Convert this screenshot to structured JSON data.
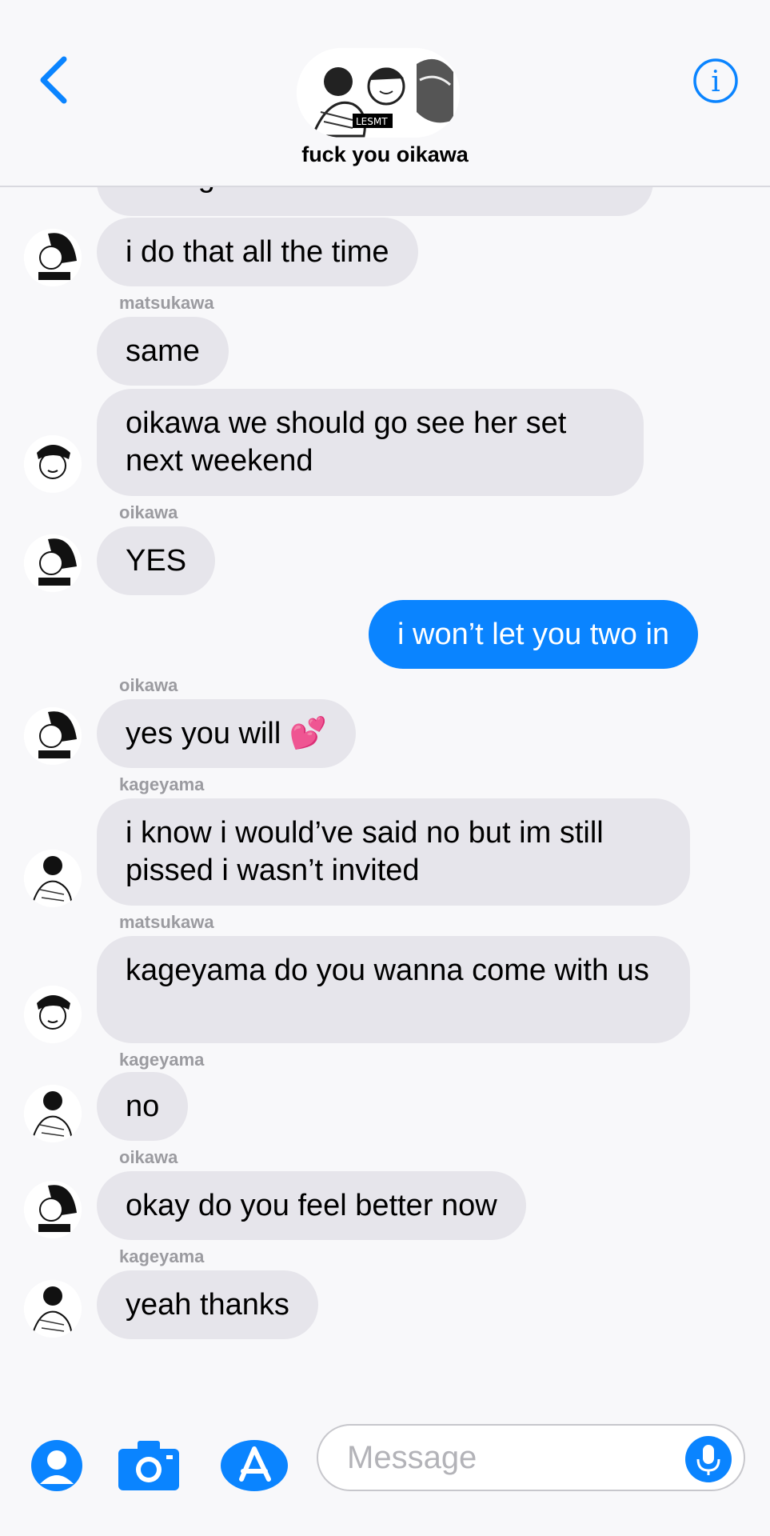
{
  "header": {
    "back_icon": "chevron-left-icon",
    "title": "fuck you oikawa",
    "info_icon": "info-icon",
    "accent": "#0a84ff"
  },
  "messages": [
    {
      "sender": "",
      "text": "lurking",
      "from": "them",
      "avatar": "oikawa"
    },
    {
      "sender": "",
      "text": "i do that all the time",
      "from": "them",
      "avatar": "oikawa"
    },
    {
      "sender": "matsukawa",
      "text": "same",
      "from": "them",
      "avatar": "matsukawa"
    },
    {
      "sender": "",
      "text": "oikawa we should go see her set next weekend",
      "from": "them",
      "avatar": "matsukawa"
    },
    {
      "sender": "oikawa",
      "text": "YES",
      "from": "them",
      "avatar": "oikawa"
    },
    {
      "sender": "",
      "text": "i won’t let you two in",
      "from": "me"
    },
    {
      "sender": "oikawa",
      "text": "yes you will 💕",
      "from": "them",
      "avatar": "oikawa"
    },
    {
      "sender": "kageyama",
      "text": "i know i would’ve said no but im still pissed i wasn’t invited",
      "from": "them",
      "avatar": "kageyama"
    },
    {
      "sender": "matsukawa",
      "text": "kageyama do you wanna come with us",
      "from": "them",
      "avatar": "matsukawa"
    },
    {
      "sender": "kageyama",
      "text": "no",
      "from": "them",
      "avatar": "kageyama"
    },
    {
      "sender": "oikawa",
      "text": "okay do you feel better now",
      "from": "them",
      "avatar": "oikawa"
    },
    {
      "sender": "kageyama",
      "text": "yeah thanks",
      "from": "them",
      "avatar": "kageyama"
    }
  ],
  "composer": {
    "placeholder": "Message",
    "icons": [
      "memoji-icon",
      "camera-icon",
      "app-store-icon",
      "microphone-icon"
    ]
  }
}
